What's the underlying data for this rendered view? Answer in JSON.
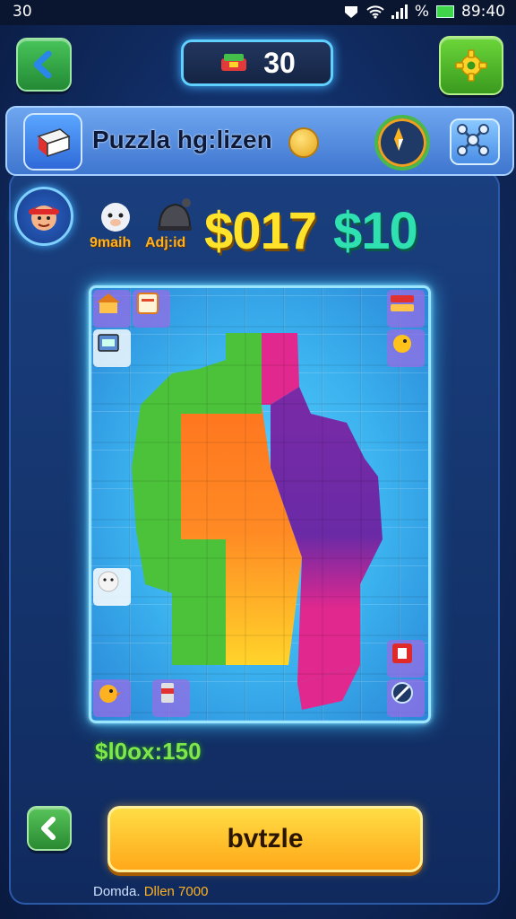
{
  "status_bar": {
    "left_text": "30",
    "right_text": "% ",
    "time": "89:40",
    "battery_color": "#3fd64a"
  },
  "header": {
    "score": "30",
    "back_icon": "chevron-left-icon",
    "settings_icon": "gear-icon"
  },
  "title_bar": {
    "title": "Puzzla hg:lizen",
    "coin_icon": "coin-icon",
    "card_icon": "card-icon",
    "compass_icon": "compass-icon",
    "share_icon": "network-icon"
  },
  "player_row": {
    "chips": [
      {
        "label": "9maih",
        "icon": "sheep-icon"
      },
      {
        "label": "Adj:id",
        "icon": "bell-icon"
      }
    ],
    "score_main": "$017",
    "score_bonus": "$10"
  },
  "board": {
    "colors": {
      "green": "#4cc23a",
      "orange": "#ff7a1c",
      "magenta": "#e0288e",
      "purple": "#6a2aa6",
      "yellow": "#ffd42a"
    },
    "corner_items": [
      "hut-icon",
      "note-icon",
      "cabinet-icon",
      "book-icon",
      "duck-icon",
      "sheep-icon",
      "bird-icon",
      "can-icon",
      "tag-icon",
      "compass-icon"
    ]
  },
  "bonus_text": "$l0ox:150",
  "actions": {
    "play_label": "bvtzle",
    "back_icon": "chevron-left-icon"
  },
  "footer": {
    "prefix": "Domda.",
    "value": "Dllen 7000"
  }
}
